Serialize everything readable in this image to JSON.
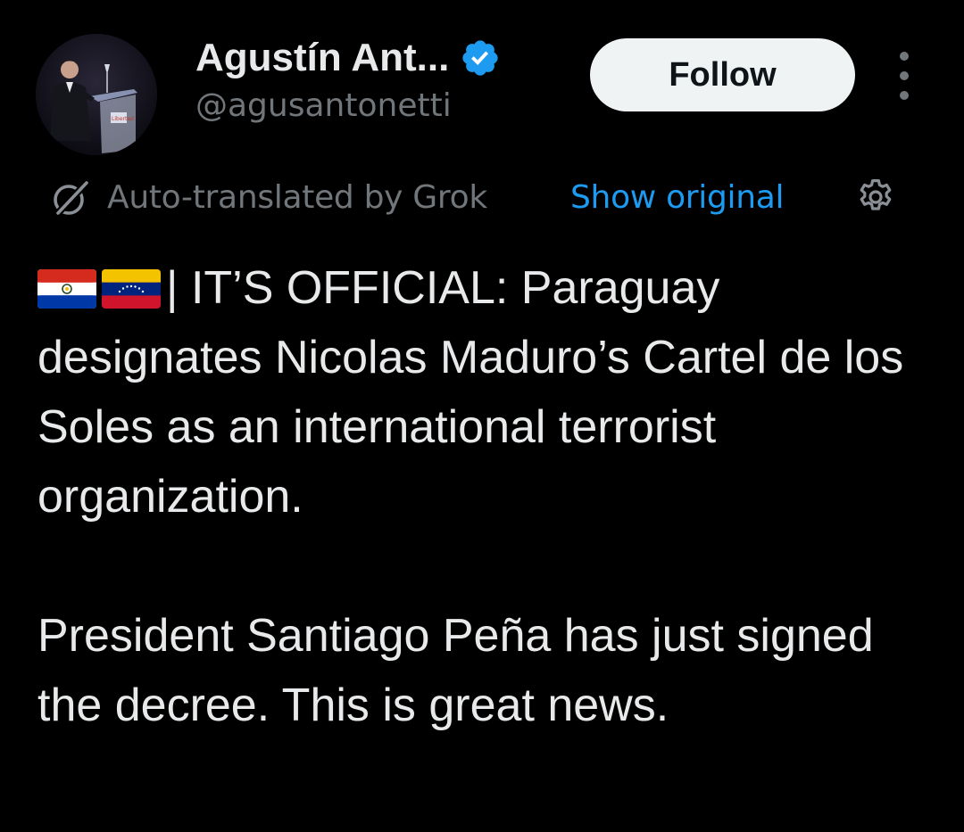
{
  "author": {
    "display_name": "Agustín Ant...",
    "handle": "@agusantonetti",
    "verified": true,
    "avatar_icon": "profile-photo-speaker-at-podium",
    "avatar_podium_text": "Libertad"
  },
  "actions": {
    "follow_label": "Follow",
    "more_icon": "more-vertical-icon"
  },
  "translation": {
    "icon": "grok-icon",
    "label": "Auto-translated by Grok",
    "show_original_label": "Show original",
    "settings_icon": "gear-icon"
  },
  "tweet": {
    "flags": [
      "paraguay-flag-icon",
      "venezuela-flag-icon"
    ],
    "paragraph1": "| IT’S OFFICIAL: Paraguay designates Nicolas Maduro’s Cartel de los Soles as an international terrorist organization.",
    "paragraph2": "President Santiago Peña has just signed the decree. This is great news."
  },
  "colors": {
    "background": "#000000",
    "text_primary": "#e7e9ea",
    "text_secondary": "#71767b",
    "accent": "#1d9bf0",
    "follow_bg": "#eff3f4"
  }
}
